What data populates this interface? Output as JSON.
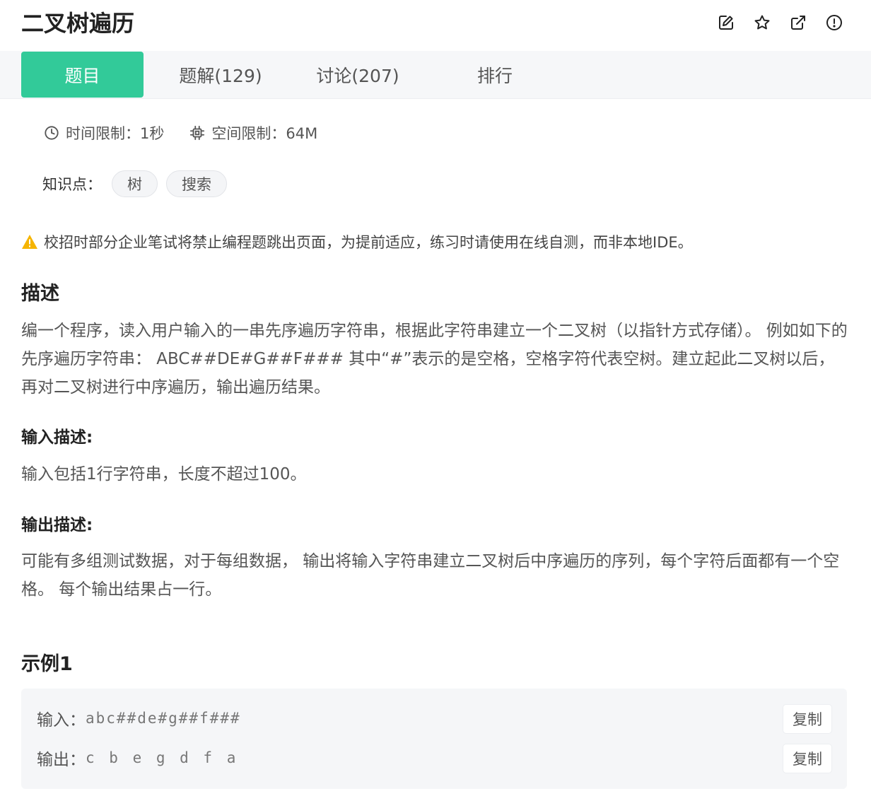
{
  "header": {
    "title": "二叉树遍历",
    "icons": [
      "edit-icon",
      "star-icon",
      "external-link-icon",
      "report-icon"
    ]
  },
  "tabs": [
    {
      "label": "题目",
      "active": true
    },
    {
      "label": "题解(129)",
      "active": false
    },
    {
      "label": "讨论(207)",
      "active": false
    },
    {
      "label": "排行",
      "active": false
    }
  ],
  "limits": {
    "time": "时间限制：1秒",
    "space": "空间限制：64M"
  },
  "knowledge": {
    "label": "知识点：",
    "tags": [
      "树",
      "搜索"
    ]
  },
  "warning": "校招时部分企业笔试将禁止编程题跳出页面，为提前适应，练习时请使用在线自测，而非本地IDE。",
  "description": {
    "title": "描述",
    "text": "编一个程序，读入用户输入的一串先序遍历字符串，根据此字符串建立一个二叉树（以指针方式存储）。 例如如下的先序遍历字符串： ABC##DE#G##F### 其中“#”表示的是空格，空格字符代表空树。建立起此二叉树以后，再对二叉树进行中序遍历，输出遍历结果。"
  },
  "input_desc": {
    "title": "输入描述:",
    "text": "输入包括1行字符串，长度不超过100。"
  },
  "output_desc": {
    "title": "输出描述:",
    "text": "可能有多组测试数据，对于每组数据， 输出将输入字符串建立二叉树后中序遍历的序列，每个字符后面都有一个空格。 每个输出结果占一行。"
  },
  "example": {
    "title": "示例1",
    "input_label": "输入：",
    "input_value": "abc##de#g##f###",
    "output_label": "输出：",
    "output_value": "c b e g d f a",
    "copy_label": "复制"
  },
  "colors": {
    "accent": "#32ca99",
    "warning": "#f5b400"
  }
}
